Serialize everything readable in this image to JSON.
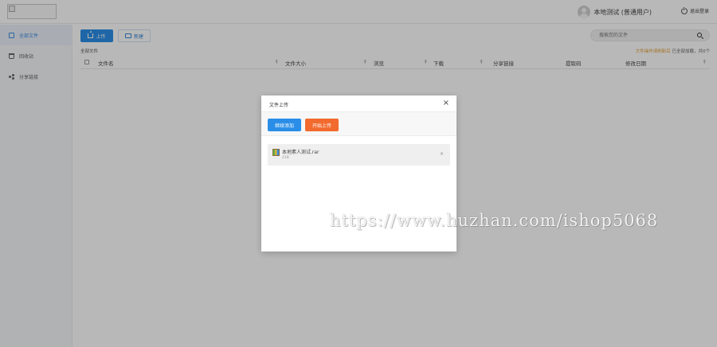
{
  "header": {
    "user_name": "本地测试 (普通用户)",
    "logout_label": "退出登录"
  },
  "sidebar": {
    "items": [
      {
        "label": "全部文件",
        "icon": "folder-icon",
        "active": true
      },
      {
        "label": "回收站",
        "icon": "trash-icon",
        "active": false
      },
      {
        "label": "分享链接",
        "icon": "share-icon",
        "active": false
      }
    ]
  },
  "toolbar": {
    "upload_label": "上传",
    "newdir_label": "新建"
  },
  "search": {
    "placeholder": "搜索您的文件"
  },
  "breadcrumb": "全部文件",
  "status": {
    "warn": "文件操作请刷新后",
    "loaded": "已全部加载，共0个"
  },
  "table": {
    "columns": [
      "文件名",
      "文件大小",
      "浏览",
      "下载",
      "分享链接",
      "提取码",
      "修改日期"
    ]
  },
  "modal": {
    "title": "文件上传",
    "close_symbol": "×",
    "continue_label": "继续添加",
    "start_label": "开始上传",
    "file": {
      "name": "本地素人测试.rar",
      "size": "21B",
      "remove_symbol": "×"
    }
  },
  "watermark": "https://www.huzhan.com/ishop5068",
  "colors": {
    "accent_blue": "#2a8ee8",
    "start_orange": "#f26a2e"
  }
}
